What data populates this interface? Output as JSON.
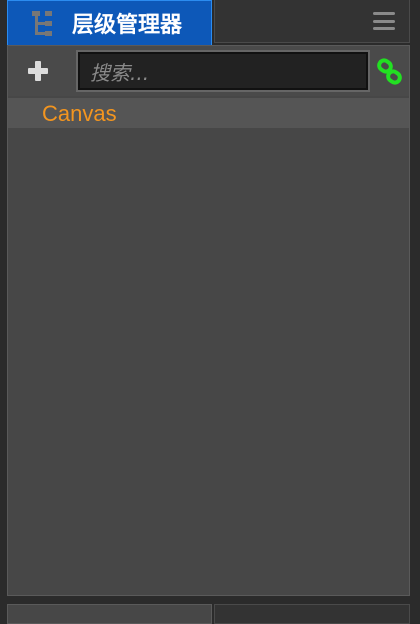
{
  "tab": {
    "title": "层级管理器",
    "icon": "hierarchy-icon"
  },
  "toolbar": {
    "add_icon": "plus-icon",
    "search_placeholder": "搜索...",
    "link_icon": "link-icon",
    "link_color": "#22e022"
  },
  "tree": {
    "items": [
      {
        "label": "Canvas",
        "color": "#f3951f"
      }
    ]
  }
}
